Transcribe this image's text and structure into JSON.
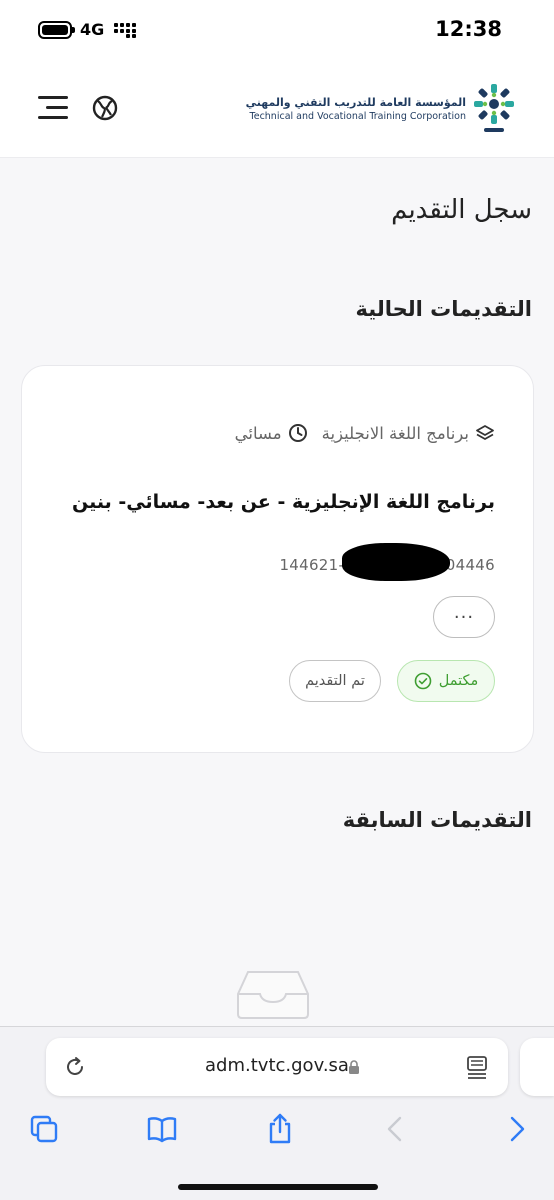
{
  "status_bar": {
    "network": "4G",
    "time": "12:38"
  },
  "header": {
    "org_name_ar": "المؤسسة العامة للتدريب التقني والمهني",
    "org_name_en": "Technical and Vocational Training Corporation",
    "menu_icon": "hamburger-menu-icon",
    "language_icon": "globe-icon"
  },
  "page": {
    "title": "سجل التقديم",
    "current_section_title": "التقديمات الحالية",
    "previous_section_title": "التقديمات السابقة"
  },
  "application_card": {
    "program_type": "برنامج اللغة الانجليزية",
    "period": "مسائي",
    "program_name": "برنامج اللغة الإنجليزية - عن بعد- مسائي- بنين",
    "reference_prefix": "144621-",
    "reference_suffix": "-204446",
    "more_label": "···",
    "status_complete": "مكتمل",
    "status_applied": "تم التقديم"
  },
  "browser": {
    "url": "adm.tvtc.gov.sa"
  },
  "colors": {
    "complete_green": "#3f9e32",
    "safari_blue": "#2f7cf6",
    "brand_navy": "#1e3a5f"
  }
}
